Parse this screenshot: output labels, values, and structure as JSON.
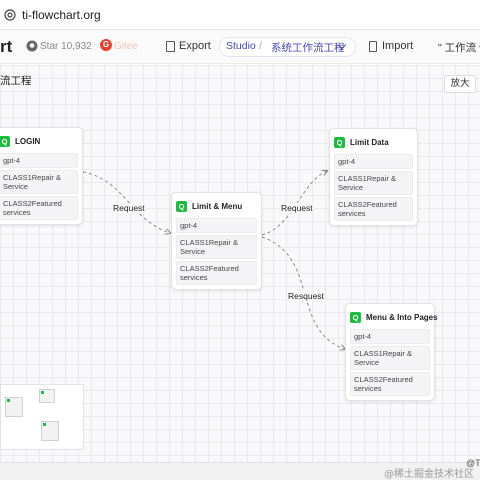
{
  "browser": {
    "url": "ti-flowchart.org"
  },
  "toolbar": {
    "brand": "rt",
    "star_label": "Star 10,932",
    "gitee_label": "Gitee",
    "export_label": "Export",
    "studio_label": "Studio",
    "separator": "/",
    "project_label": "系统工作流工程",
    "import_label": "Import",
    "workflow_label": "\" 工作流 使"
  },
  "canvas": {
    "title": "流工程",
    "zoom_button": "放大"
  },
  "nodes": [
    {
      "title": "LOGIN",
      "fields": [
        "gpt-4",
        "CLASS1Repair & Service",
        "CLASS2Featured services"
      ]
    },
    {
      "title": "Limit & Menu",
      "fields": [
        "gpt-4",
        "CLASS1Repair & Service",
        "CLASS2Featured services"
      ]
    },
    {
      "title": "Limit Data",
      "fields": [
        "gpt-4",
        "CLASS1Repair & Service",
        "CLASS2Featured services"
      ]
    },
    {
      "title": "Menu & Into Pages",
      "fields": [
        "gpt-4",
        "CLASS1Repair & Service",
        "CLASS2Featured services"
      ]
    }
  ],
  "edges": [
    {
      "from": "LOGIN",
      "to": "Limit & Menu",
      "label": "Request"
    },
    {
      "from": "Limit & Menu",
      "to": "Limit Data",
      "label": "Request"
    },
    {
      "from": "Limit & Menu",
      "to": "Menu & Into Pages",
      "label": "Resquest"
    }
  ],
  "statusbar": {
    "text": "@T",
    "watermark": "@稀土掘金技术社区"
  },
  "colors": {
    "accent": "#4a47b8",
    "node_icon": "#1cbc3c",
    "edge": "#8a8a8a"
  }
}
